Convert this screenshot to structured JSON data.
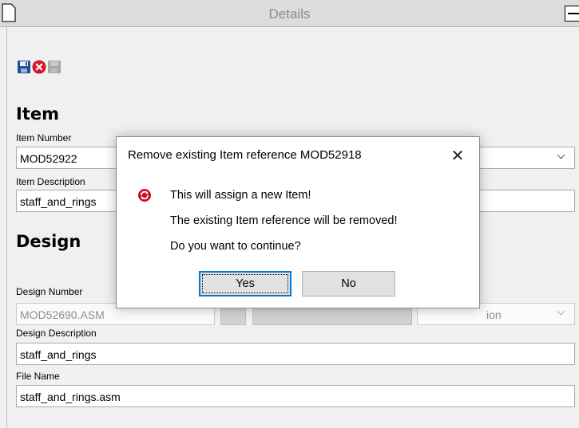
{
  "window": {
    "title": "Details"
  },
  "toolbar": {
    "icons": [
      "save-icon",
      "cancel-icon",
      "disabled-action-icon"
    ]
  },
  "item": {
    "heading": "Item",
    "number_label": "Item Number",
    "number_value": "MOD52922",
    "description_label": "Item Description",
    "description_value": "staff_and_rings"
  },
  "design": {
    "heading": "Design",
    "number_label": "Design Number",
    "number_value": "MOD52690.ASM",
    "status_value": "ion",
    "description_label": "Design Description",
    "description_value": "staff_and_rings",
    "file_label": "File Name",
    "file_value": "staff_and_rings.asm"
  },
  "dialog": {
    "title": "Remove existing Item reference MOD52918",
    "close_glyph": "✕",
    "icon": "warning-refresh-icon",
    "lines": [
      "This will assign a new Item!",
      "The existing Item reference will be removed!",
      "Do you want to continue?"
    ],
    "yes_label": "Yes",
    "no_label": "No"
  },
  "colors": {
    "accent": "#0078d7",
    "save_icon": "#1e4f9c",
    "cancel_icon": "#e0162b"
  }
}
